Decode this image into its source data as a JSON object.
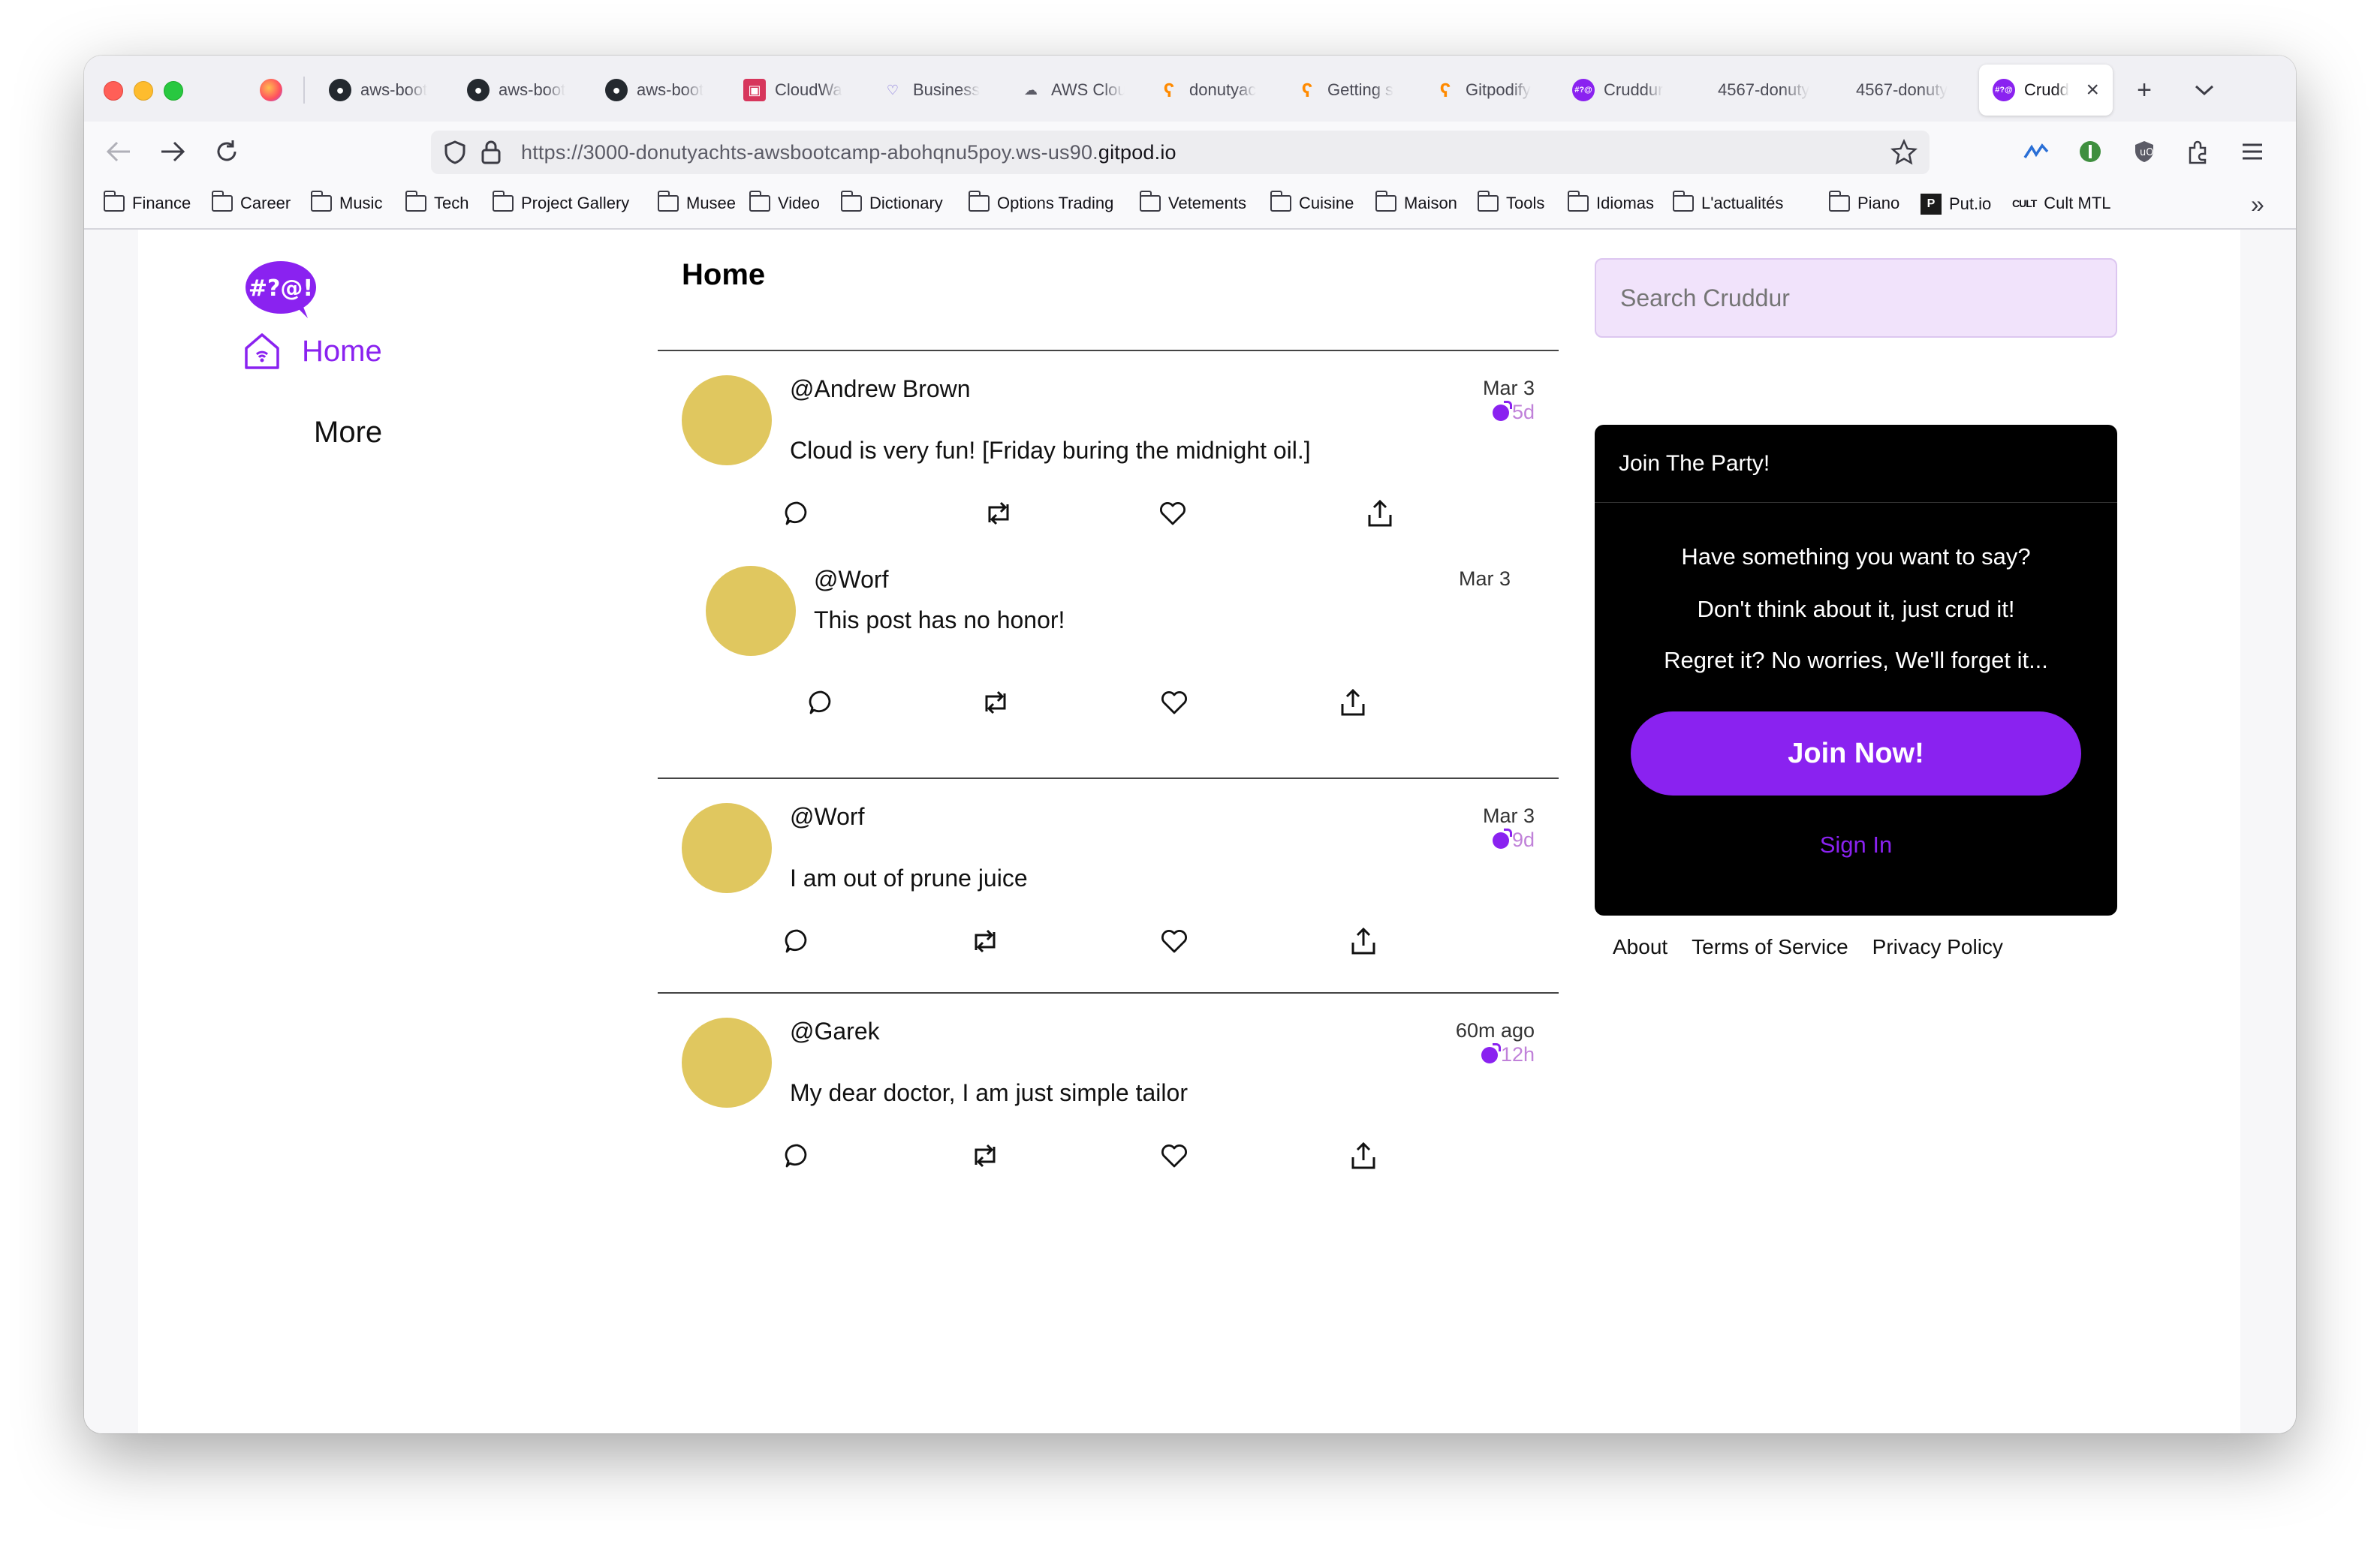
{
  "browser": {
    "tabs": [
      {
        "label": "aws-boot",
        "icon": "github-icon"
      },
      {
        "label": "aws-boot",
        "icon": "github-icon"
      },
      {
        "label": "aws-boot",
        "icon": "github-icon"
      },
      {
        "label": "CloudWa",
        "icon": "cloudwatch-icon"
      },
      {
        "label": "Business",
        "icon": "business-icon"
      },
      {
        "label": "AWS Clou",
        "icon": "cloud-icon"
      },
      {
        "label": "donutyac",
        "icon": "gitpod-icon"
      },
      {
        "label": "Getting s",
        "icon": "gitpod-icon"
      },
      {
        "label": "Gitpodify",
        "icon": "gitpod-icon"
      },
      {
        "label": "Cruddur",
        "icon": "cruddur-icon"
      },
      {
        "label": "4567-donuty",
        "icon": "none"
      },
      {
        "label": "4567-donuty",
        "icon": "none"
      },
      {
        "label": "Crudd",
        "icon": "cruddur-icon",
        "active": true
      }
    ],
    "url_prefix": "https://3000-donutyachts-awsbootcamp-abohqnu5poy.ws-us90.",
    "url_domain": "gitpod.io",
    "bookmarks": [
      "Finance",
      "Career",
      "Music",
      "Tech",
      "Project Gallery",
      "Musee",
      "Video",
      "Dictionary",
      "Options Trading",
      "Vetements",
      "Cuisine",
      "Maison",
      "Tools",
      "Idiomas",
      "L'actualités",
      "Piano",
      "Put.io",
      "Cult MTL"
    ]
  },
  "sidebar": {
    "home": "Home",
    "more": "More",
    "logo_text": "#?@!"
  },
  "feed": {
    "title": "Home",
    "posts": [
      {
        "handle": "@Andrew Brown",
        "message": "Cloud is very fun! [Friday buring the midnight oil.]",
        "date": "Mar 3",
        "expires": "5d"
      },
      {
        "handle": "@Worf",
        "message": "This post has no honor!",
        "date": "Mar 3"
      },
      {
        "handle": "@Worf",
        "message": "I am out of prune juice",
        "date": "Mar 3",
        "expires": "9d"
      },
      {
        "handle": "@Garek",
        "message": "My dear doctor, I am just simple tailor",
        "date": "60m ago",
        "expires": "12h"
      }
    ]
  },
  "search": {
    "placeholder": "Search Cruddur"
  },
  "join": {
    "title": "Join The Party!",
    "line1": "Have something you want to say?",
    "line2": "Don't think about it, just crud it!",
    "line3": "Regret it? No worries, We'll forget it...",
    "button": "Join Now!",
    "signin": "Sign In"
  },
  "footer": {
    "about": "About",
    "terms": "Terms of Service",
    "privacy": "Privacy Policy"
  },
  "colors": {
    "accent": "#8a22f0",
    "avatar": "#e0c75f",
    "search_bg": "#f1e3fb",
    "expire": "#c081d9"
  }
}
